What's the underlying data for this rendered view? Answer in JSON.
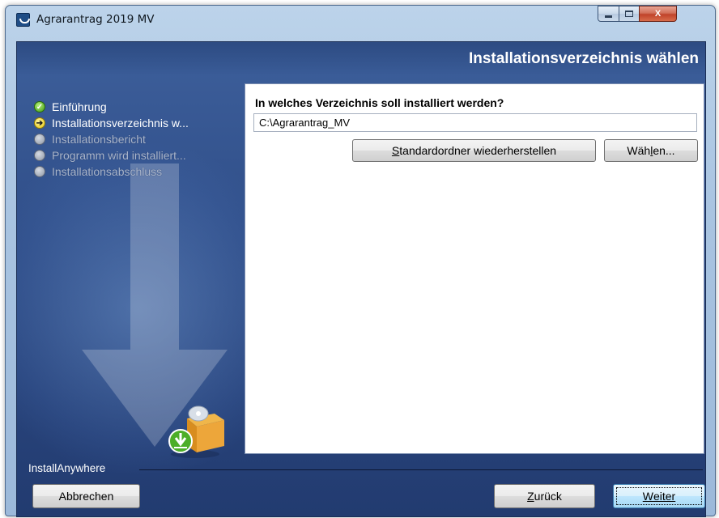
{
  "window": {
    "title": "Agrarantrag 2019 MV",
    "controls": {
      "minimize_icon": "minimize-icon",
      "maximize_icon": "maximize-icon",
      "close_label": "X"
    }
  },
  "header": {
    "title": "Installationsverzeichnis wählen"
  },
  "steps": [
    {
      "label": "Einführung",
      "state": "done",
      "icon": "check-icon"
    },
    {
      "label": "Installationsverzeichnis w...",
      "state": "current",
      "icon": "arrow-right-icon"
    },
    {
      "label": "Installationsbericht",
      "state": "pending",
      "icon": "circle-icon"
    },
    {
      "label": "Programm wird installiert...",
      "state": "pending",
      "icon": "circle-icon"
    },
    {
      "label": "Installationsabschluss",
      "state": "pending",
      "icon": "circle-icon"
    }
  ],
  "main": {
    "question": "In welches Verzeichnis soll installiert werden?",
    "path_value": "C:\\Agrarantrag_MV",
    "restore_button": {
      "mnemonic": "S",
      "rest": "tandardordner wiederherstellen"
    },
    "choose_button": {
      "prefix": "Wäh",
      "mnemonic": "l",
      "rest": "en..."
    }
  },
  "footer": {
    "vendor": "InstallAnywhere",
    "cancel_label": "Abbrechen",
    "back_button": {
      "mnemonic": "Z",
      "rest": "urück"
    },
    "next_button": {
      "mnemonic": "W",
      "rest": "eiter"
    }
  },
  "colors": {
    "panel_bg": "#2e4c86",
    "header_text": "#ffffff",
    "step_done": "#3f9a12",
    "step_current": "#e7c710",
    "step_pending": "#8e97a5"
  }
}
